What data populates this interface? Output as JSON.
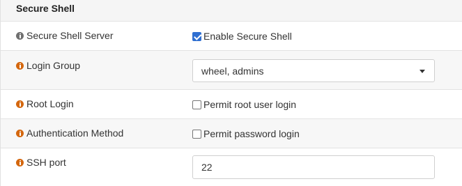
{
  "section": {
    "title": "Secure Shell"
  },
  "rows": [
    {
      "label": "Secure Shell Server",
      "icon": "info-icon",
      "icon_color": "#707070",
      "control": {
        "type": "checkbox",
        "checked": true,
        "label": "Enable Secure Shell"
      }
    },
    {
      "label": "Login Group",
      "icon": "info-icon",
      "icon_color": "#d4670e",
      "control": {
        "type": "select",
        "value": "wheel, admins",
        "caret_icon": "caret-down-icon"
      }
    },
    {
      "label": "Root Login",
      "icon": "info-icon",
      "icon_color": "#d4670e",
      "control": {
        "type": "checkbox",
        "checked": false,
        "label": "Permit root user login"
      }
    },
    {
      "label": "Authentication Method",
      "icon": "info-icon",
      "icon_color": "#d4670e",
      "control": {
        "type": "checkbox",
        "checked": false,
        "label": "Permit password login"
      }
    },
    {
      "label": "SSH port",
      "icon": "info-icon",
      "icon_color": "#d4670e",
      "control": {
        "type": "text",
        "value": "22"
      }
    }
  ],
  "colors": {
    "checkbox_checked": "#2f6fd1",
    "row_alt_bg": "#f7f7f7",
    "header_bg": "#f5f5f5"
  }
}
